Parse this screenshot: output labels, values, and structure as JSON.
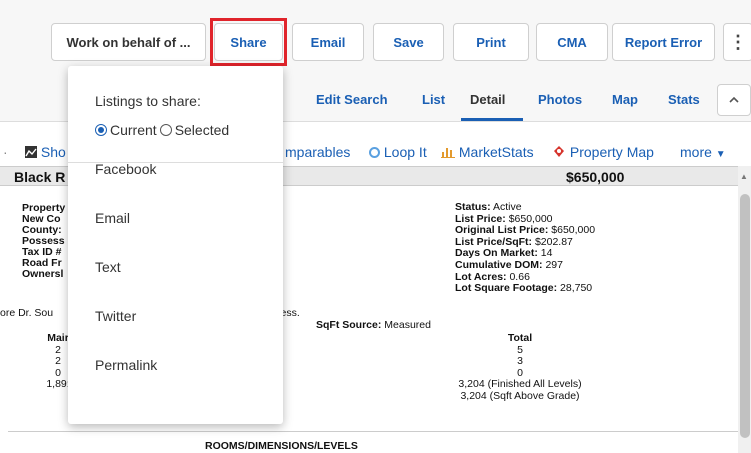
{
  "toolbar": {
    "work_on_behalf": "Work on behalf of ...",
    "share": "Share",
    "email": "Email",
    "save": "Save",
    "print": "Print",
    "cma": "CMA",
    "report_error": "Report Error",
    "more": "⋮",
    "highlight_color": "#e0242b"
  },
  "nav": {
    "edit_search": "Edit Search",
    "list": "List",
    "detail": "Detail",
    "photos": "Photos",
    "map": "Map",
    "stats": "Stats",
    "collapse": "^",
    "active": "Detail"
  },
  "actions": {
    "show_partial": "Sho",
    "comparables_partial": "mparables",
    "loop_it": "Loop It",
    "market_stats": "MarketStats",
    "property_map": "Property Map",
    "more": "more"
  },
  "report": {
    "title_partial": "Black R",
    "price": "$650,000",
    "labels": [
      "Property",
      "New Co",
      "County:",
      "Possess",
      "Tax ID #",
      "Road Fr",
      "Ownersl"
    ],
    "status": {
      "label": "Status:",
      "value": "Active"
    },
    "list_price": {
      "label": "List Price:",
      "value": "$650,000"
    },
    "original_list_price": {
      "label": "Original List Price:",
      "value": "$650,000"
    },
    "price_sqft": {
      "label": "List Price/SqFt:",
      "value": "$202.87"
    },
    "days_on_market": {
      "label": "Days On Market:",
      "value": "14"
    },
    "cumulative_dom": {
      "label": "Cumulative DOM:",
      "value": "297"
    },
    "lot_acres": {
      "label": "Lot Acres:",
      "value": "0.66"
    },
    "lot_sqft": {
      "label": "Lot Square Footage:",
      "value": "28,750"
    },
    "address_partial_left": "ore Dr. Sou",
    "address_partial_right": "ress.",
    "sqft_source": {
      "label": "SqFt Source:",
      "value": "Measured"
    },
    "main_header_partial": "Mair",
    "main_values": [
      "2",
      "2",
      "0",
      "1,89:"
    ],
    "total_header": "Total",
    "total_values": [
      "5",
      "3",
      "0",
      "3,204 (Finished All Levels)",
      "3,204 (Sqft Above Grade)"
    ],
    "rooms_title": "ROOMS/DIMENSIONS/LEVELS"
  },
  "dropdown": {
    "heading": "Listings to share:",
    "radio_current": "Current",
    "radio_selected": "Selected",
    "selected_option": "Current",
    "items": [
      "Facebook",
      "Email",
      "Text",
      "Twitter",
      "Permalink"
    ]
  },
  "colors": {
    "link": "#1a5fb4",
    "text": "#333333"
  }
}
